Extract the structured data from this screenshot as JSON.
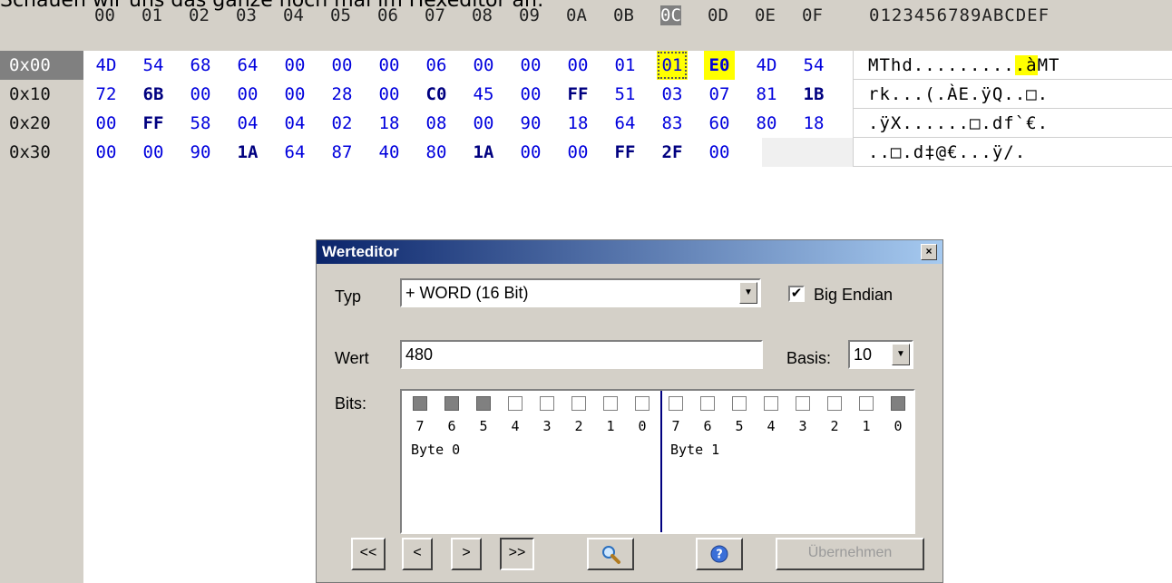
{
  "caption": "Schauen wir uns das ganze noch mal im Hexeditor an:",
  "hex_header": [
    "00",
    "01",
    "02",
    "03",
    "04",
    "05",
    "06",
    "07",
    "08",
    "09",
    "0A",
    "0B",
    "0C",
    "0D",
    "0E",
    "0F"
  ],
  "ascii_header": "0123456789ABCDEF",
  "rows": [
    {
      "label": "0x00",
      "bytes": [
        "4D",
        "54",
        "68",
        "64",
        "00",
        "00",
        "00",
        "06",
        "00",
        "00",
        "00",
        "01",
        "01",
        "E0",
        "4D",
        "54"
      ],
      "ascii_a": "MThd.........",
      "ascii_b": ".à",
      "ascii_c": "MT"
    },
    {
      "label": "0x10",
      "bytes": [
        "72",
        "6B",
        "00",
        "00",
        "00",
        "28",
        "00",
        "C0",
        "45",
        "00",
        "FF",
        "51",
        "03",
        "07",
        "81",
        "1B"
      ],
      "ascii_a": "rk...(.ÀE.ÿQ..□.",
      "ascii_b": "",
      "ascii_c": ""
    },
    {
      "label": "0x20",
      "bytes": [
        "00",
        "FF",
        "58",
        "04",
        "04",
        "02",
        "18",
        "08",
        "00",
        "90",
        "18",
        "64",
        "83",
        "60",
        "80",
        "18"
      ],
      "ascii_a": ".ÿX......□.df`€.",
      "ascii_b": "",
      "ascii_c": ""
    },
    {
      "label": "0x30",
      "bytes": [
        "00",
        "00",
        "90",
        "1A",
        "64",
        "87",
        "40",
        "80",
        "1A",
        "00",
        "00",
        "FF",
        "2F",
        "00"
      ],
      "ascii_a": "..□.d‡@€...ÿ/.",
      "ascii_b": "",
      "ascii_c": ""
    }
  ],
  "dialog": {
    "title": "Werteditor",
    "close": "×",
    "typ_label": "Typ",
    "typ_value": "+ WORD (16 Bit)",
    "big_endian_label": "Big Endian",
    "big_endian_checked": "✔",
    "wert_label": "Wert",
    "wert_value": "480",
    "basis_label": "Basis:",
    "basis_value": "10",
    "bits_label": "Bits:",
    "byte0_label": "Byte 0",
    "byte1_label": "Byte 1",
    "bit_numbers": [
      "7",
      "6",
      "5",
      "4",
      "3",
      "2",
      "1",
      "0"
    ],
    "byte0_bits": [
      1,
      1,
      1,
      0,
      0,
      0,
      0,
      0
    ],
    "byte1_bits": [
      0,
      0,
      0,
      0,
      0,
      0,
      0,
      1
    ],
    "btn_first": "<<",
    "btn_prev": "<",
    "btn_next": ">",
    "btn_last": ">>",
    "btn_apply": "Übernehmen"
  }
}
